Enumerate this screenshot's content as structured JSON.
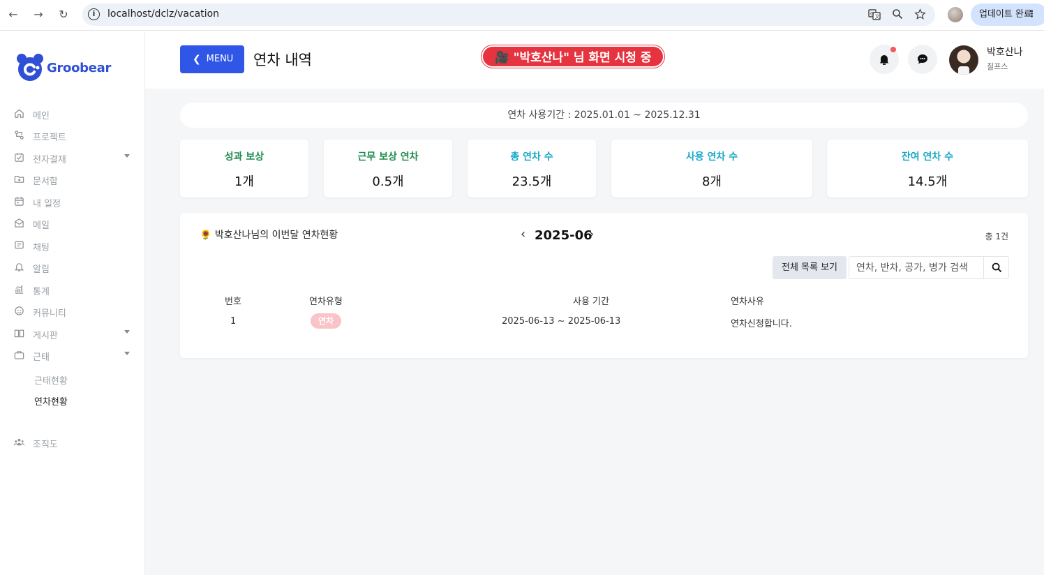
{
  "browser": {
    "url": "localhost/dclz/vacation",
    "update_label": "업데이트 완료"
  },
  "sidebar": {
    "brand": "Groobear",
    "items": [
      {
        "label": "메인",
        "icon": "home-icon",
        "has_caret": false
      },
      {
        "label": "프로젝트",
        "icon": "project-icon",
        "has_caret": false
      },
      {
        "label": "전자결재",
        "icon": "approval-icon",
        "has_caret": true
      },
      {
        "label": "문서함",
        "icon": "folder-icon",
        "has_caret": false
      },
      {
        "label": "내 일정",
        "icon": "calendar-icon",
        "has_caret": false
      },
      {
        "label": "메일",
        "icon": "mail-icon",
        "has_caret": false
      },
      {
        "label": "채팅",
        "icon": "chat-icon",
        "has_caret": false
      },
      {
        "label": "알림",
        "icon": "bell-icon",
        "has_caret": false
      },
      {
        "label": "통계",
        "icon": "stats-icon",
        "has_caret": false
      },
      {
        "label": "커뮤니티",
        "icon": "community-icon",
        "has_caret": false
      },
      {
        "label": "게시판",
        "icon": "board-icon",
        "has_caret": true
      },
      {
        "label": "근태",
        "icon": "briefcase-icon",
        "has_caret": true
      }
    ],
    "sub_items": [
      "근태현황",
      "연차현황"
    ],
    "org_label": "조직도"
  },
  "header": {
    "menu_label": "MENU",
    "page_title": "연차 내역",
    "watch_banner": "🎥 \"박호산나\" 님 화면 시청 중",
    "user_name": "박호산나",
    "user_role": "칠프스"
  },
  "period": "연차 사용기간 : 2025.01.01 ~ 2025.12.31",
  "stats": [
    {
      "label": "성과 보상",
      "value": "1개",
      "color": "#1f8a4c"
    },
    {
      "label": "근무 보상 연차",
      "value": "0.5개",
      "color": "#1f8a4c"
    },
    {
      "label": "총 연차 수",
      "value": "23.5개",
      "color": "#17a8c9"
    },
    {
      "label": "사용 연차 수",
      "value": "8개",
      "color": "#17a8c9"
    },
    {
      "label": "잔여 연차 수",
      "value": "14.5개",
      "color": "#17a8c9"
    }
  ],
  "panel": {
    "title": "🌻 박호산나님의 이번달 연차현황",
    "month": "2025-06",
    "total": "총 1건",
    "all_button": "전체 목록 보기",
    "search_placeholder": "연차, 반차, 공가, 병가 검색",
    "columns": [
      "번호",
      "연차유형",
      "사용 기간",
      "연차사유"
    ],
    "rows": [
      {
        "no": "1",
        "type": "연차",
        "period": "2025-06-13 ~ 2025-06-13",
        "reason": "연차신청합니다."
      }
    ]
  }
}
